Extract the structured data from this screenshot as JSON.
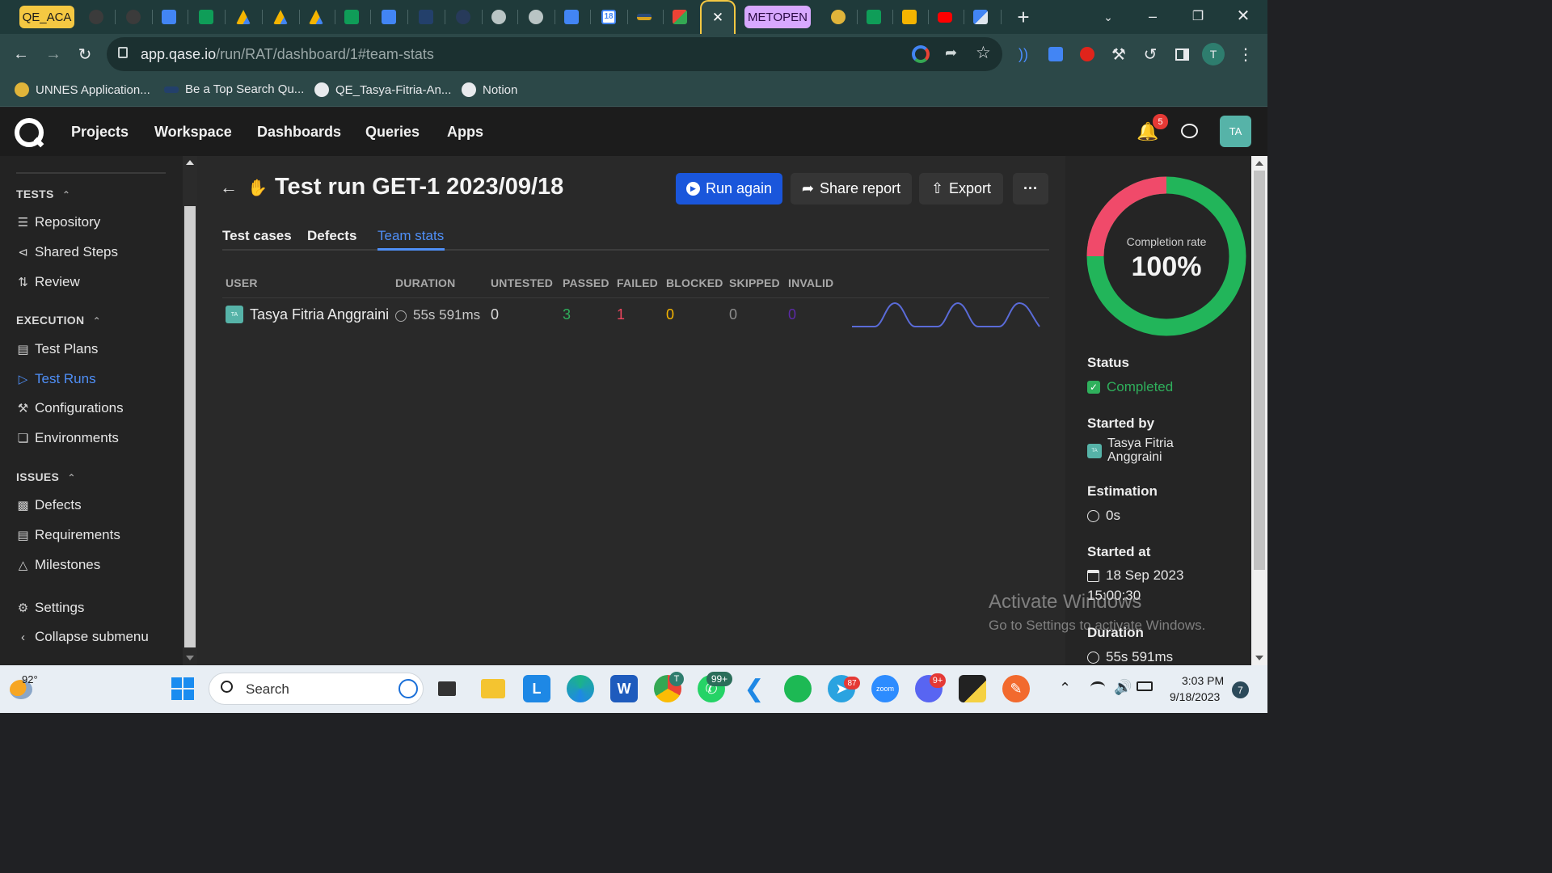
{
  "browser": {
    "tabs": {
      "qe_aca": "QE_ACA",
      "metopen": "METOPEN",
      "active_close": "✕",
      "new_tab": "+",
      "calendar_day": "18"
    },
    "url_host": "app.qase.io",
    "url_path": "/run/RAT/dashboard/1#team-stats",
    "profile_initial": "T",
    "bookmarks": [
      "UNNES Application...",
      "Be a Top Search Qu...",
      "QE_Tasya-Fitria-An...",
      "Notion"
    ]
  },
  "qase": {
    "logo": "Q",
    "nav": [
      "Projects",
      "Workspace",
      "Dashboards",
      "Queries",
      "Apps"
    ],
    "notif_count": "5",
    "avatar": "TA"
  },
  "sidebar": {
    "tests_title": "TESTS",
    "tests_items": [
      "Repository",
      "Shared Steps",
      "Review"
    ],
    "execution_title": "EXECUTION",
    "execution_items": [
      "Test Plans",
      "Test Runs",
      "Configurations",
      "Environments"
    ],
    "issues_title": "ISSUES",
    "issues_items": [
      "Defects",
      "Requirements",
      "Milestones"
    ],
    "settings": "Settings",
    "collapse": "Collapse submenu"
  },
  "run": {
    "title": "Test run GET-1 2023/09/18",
    "run_again": "Run again",
    "share_report": "Share report",
    "export": "Export",
    "more": "···",
    "tabs": [
      "Test cases",
      "Defects",
      "Team stats"
    ],
    "active_tab": "Team stats"
  },
  "table": {
    "headers": [
      "USER",
      "DURATION",
      "UNTESTED",
      "PASSED",
      "FAILED",
      "BLOCKED",
      "SKIPPED",
      "INVALID"
    ],
    "rows": [
      {
        "avatar": "TA",
        "user": "Tasya Fitria Anggraini",
        "duration": "55s 591ms",
        "untested": "0",
        "passed": "3",
        "failed": "1",
        "blocked": "0",
        "skipped": "0",
        "invalid": "0"
      }
    ]
  },
  "panel": {
    "completion_label": "Completion rate",
    "completion_value": "100%",
    "completion_fraction": 1.0,
    "status_label": "Status",
    "status_value": "Completed",
    "started_by_label": "Started by",
    "started_by_avatar": "TA",
    "started_by_value_1": "Tasya Fitria",
    "started_by_value_2": "Anggraini",
    "estimation_label": "Estimation",
    "estimation_value": "0s",
    "started_at_label": "Started at",
    "started_at_date": "18 Sep 2023",
    "started_at_time": "15:00:30",
    "duration_label": "Duration",
    "duration_value": "55s 591ms"
  },
  "watermark": {
    "line1": "Activate Windows",
    "line2": "Go to Settings to activate Windows."
  },
  "taskbar": {
    "temperature": "92°",
    "search_placeholder": "Search",
    "whatsapp_badge": "99+",
    "telegram_badge": "87",
    "discord_badge": "9+",
    "chrome_badge": "T",
    "zoom": "zoom",
    "time": "3:03 PM",
    "date": "9/18/2023",
    "notif_count": "7"
  },
  "colors": {
    "accent_blue": "#1a56db",
    "link_blue": "#4f8ff7",
    "passed": "#2fb05c",
    "failed": "#f0465f",
    "blocked": "#f5b400",
    "invalid": "#5b2aa7",
    "donut_green": "#22b55a",
    "donut_red": "#f04a6a",
    "teal_avatar": "#56b3a8"
  }
}
